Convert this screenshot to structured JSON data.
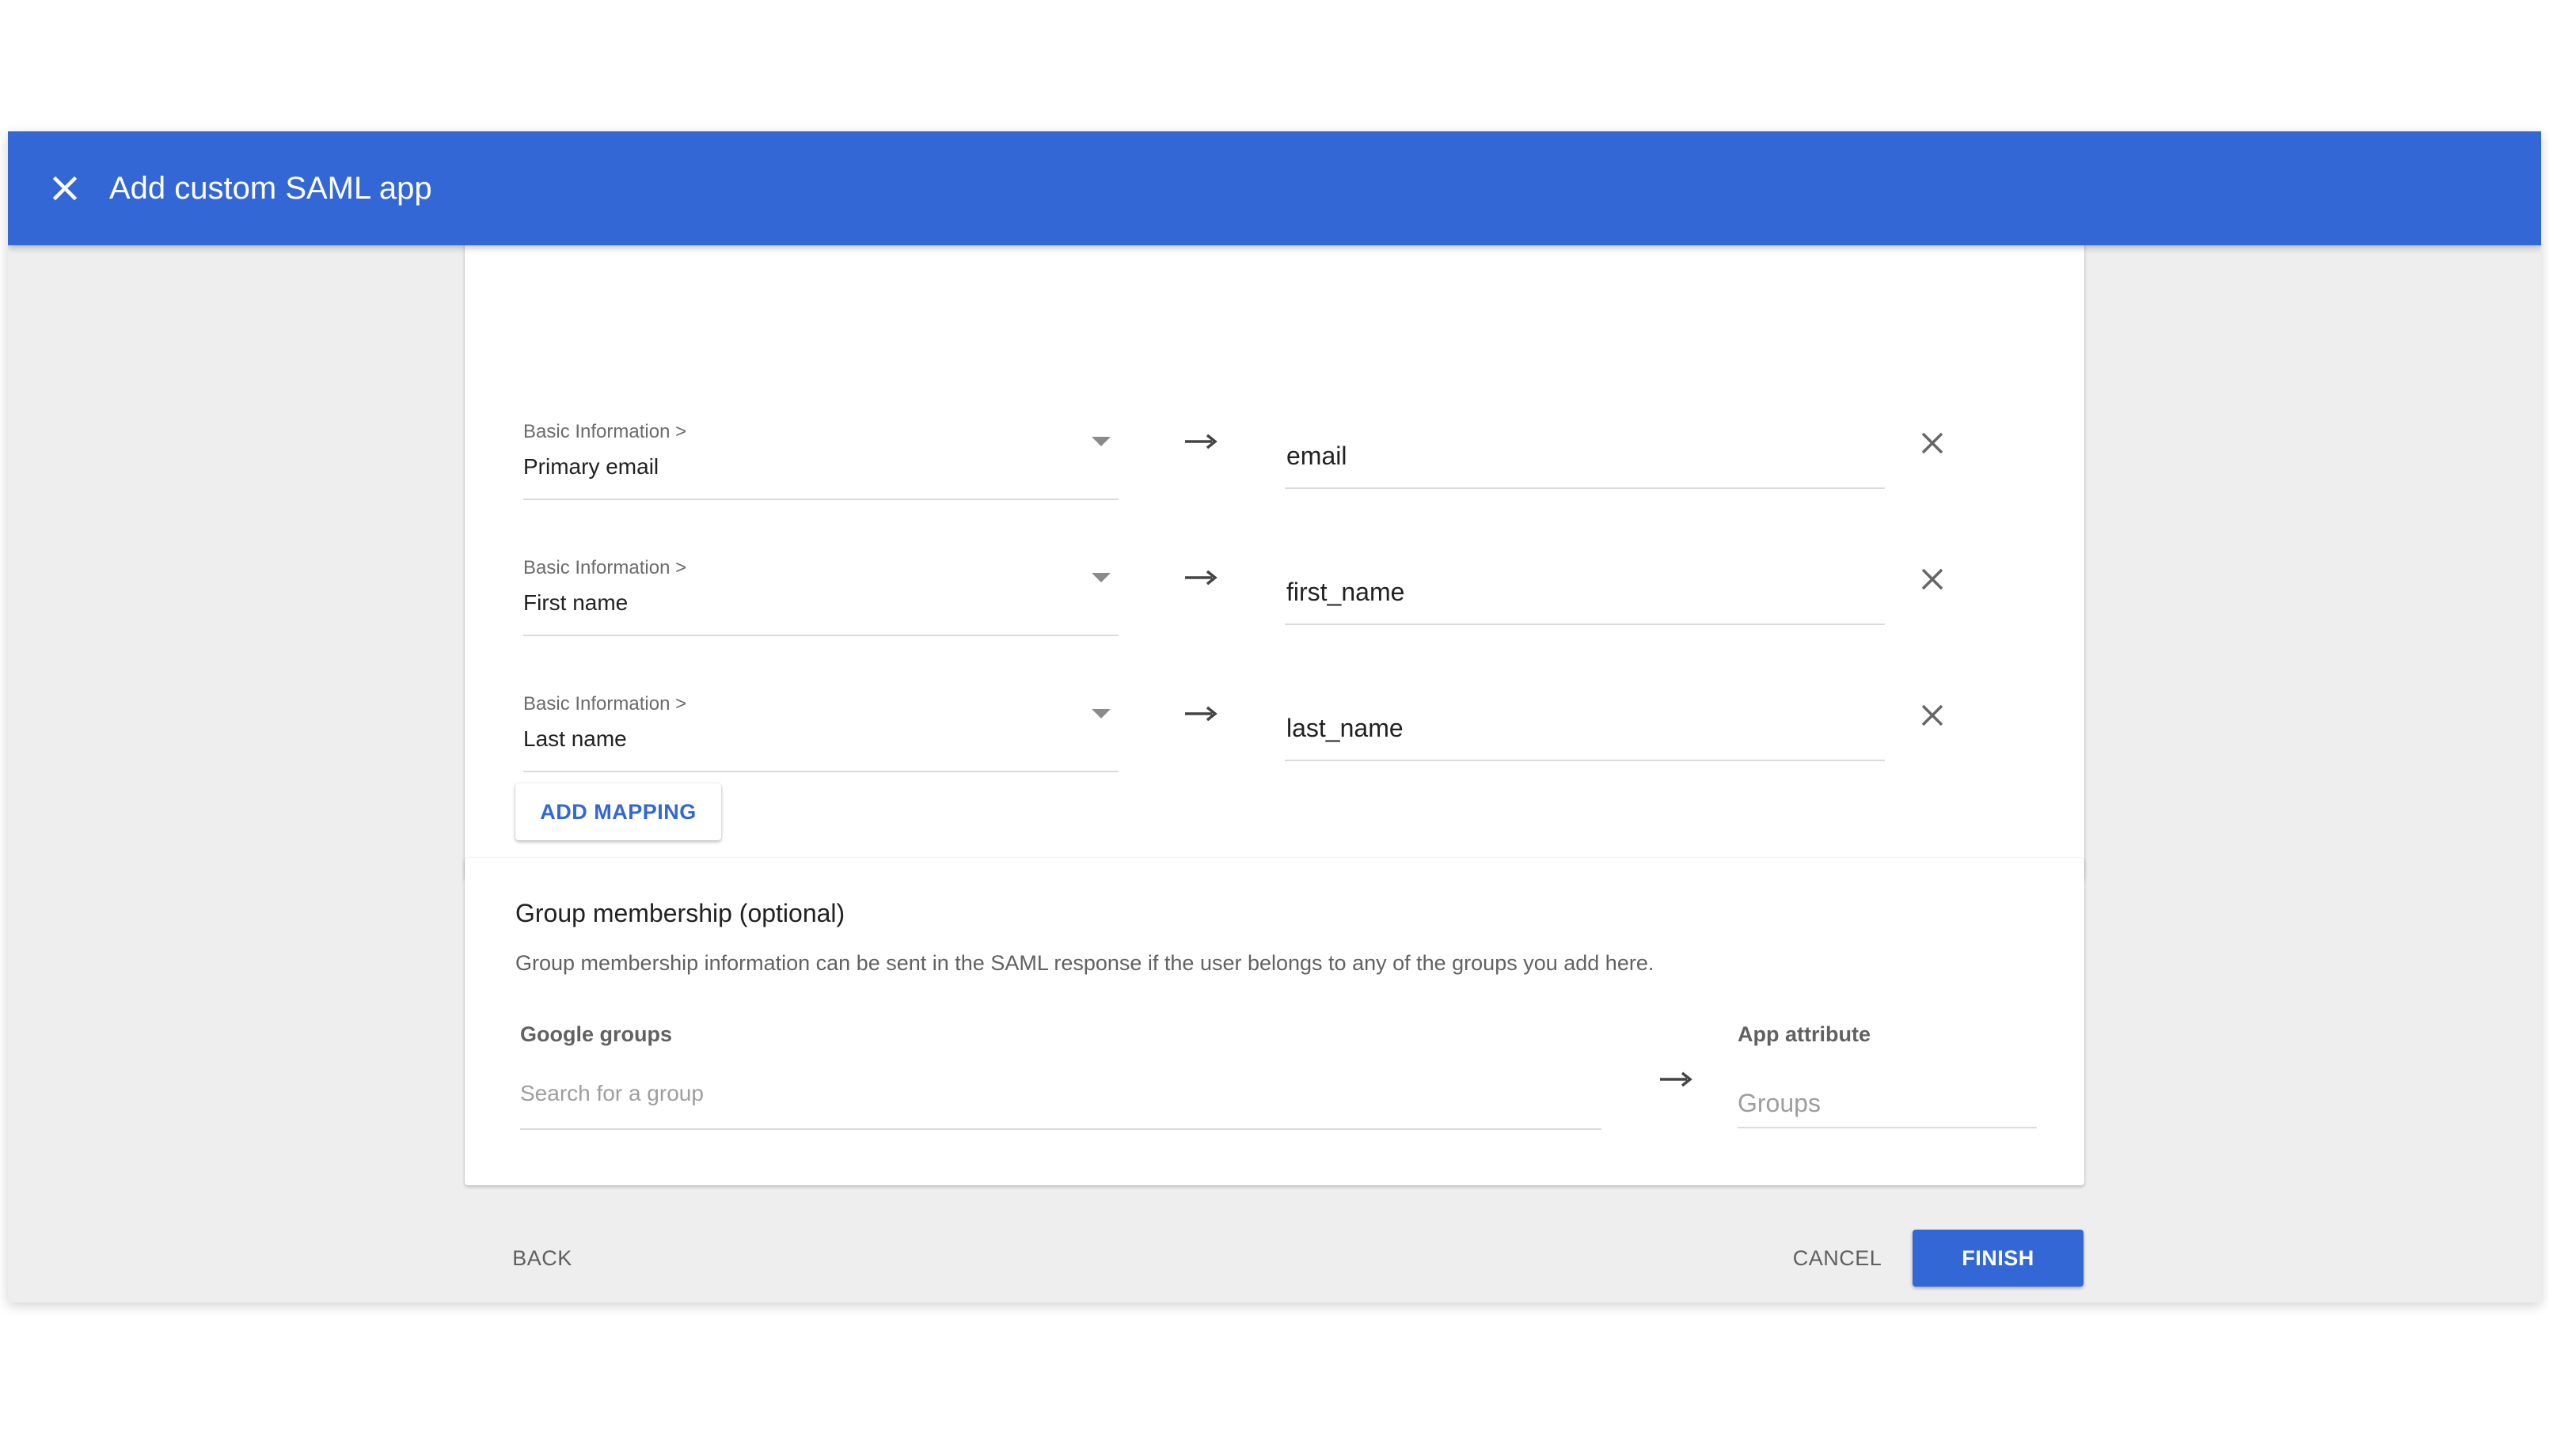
{
  "header": {
    "title": "Add custom SAML app",
    "close_icon": "close-icon",
    "background": "#3367d6"
  },
  "attribute_mappings": [
    {
      "category": "Basic Information >",
      "field": "Primary email",
      "app_attribute": "email"
    },
    {
      "category": "Basic Information >",
      "field": "First name",
      "app_attribute": "first_name"
    },
    {
      "category": "Basic Information >",
      "field": "Last name",
      "app_attribute": "last_name"
    }
  ],
  "add_mapping_label": "ADD MAPPING",
  "group_membership": {
    "title": "Group membership (optional)",
    "description": "Group membership information can be sent in the SAML response if the user belongs to any of the groups you add here.",
    "google_groups_label": "Google groups",
    "search_placeholder": "Search for a group",
    "app_attribute_label": "App attribute",
    "app_attribute_placeholder": "Groups"
  },
  "footer": {
    "back_label": "BACK",
    "cancel_label": "CANCEL",
    "finish_label": "FINISH"
  },
  "colors": {
    "accent": "#3367d6",
    "panel_background": "#eeeeee"
  }
}
